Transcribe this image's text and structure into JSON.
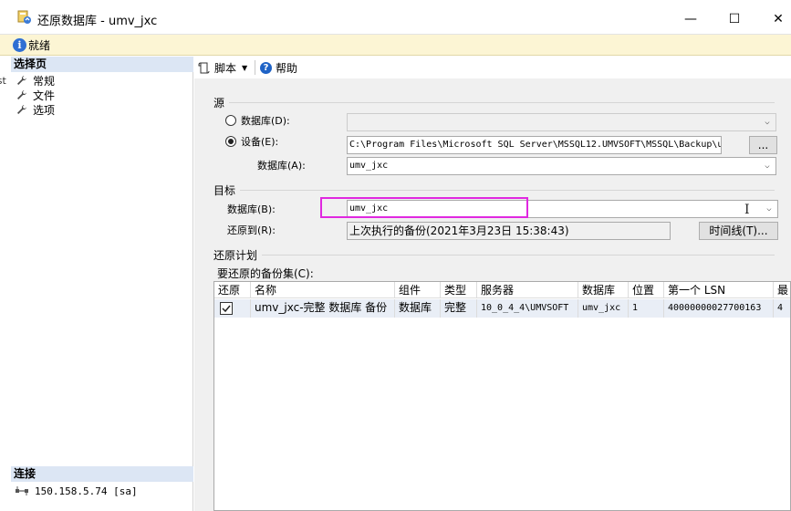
{
  "window": {
    "title": "还原数据库 - umv_jxc",
    "minimize_glyph": "—",
    "maximize_glyph": "☐",
    "close_glyph": "✕"
  },
  "status": {
    "icon": "info-icon",
    "text": "就绪"
  },
  "left_strip_text": "est",
  "sidebar": {
    "pages_header": "选择页",
    "items": [
      {
        "label": "常规",
        "icon": "wrench-icon"
      },
      {
        "label": "文件",
        "icon": "wrench-icon"
      },
      {
        "label": "选项",
        "icon": "wrench-icon"
      }
    ],
    "connection_header": "连接",
    "connection": "150.158.5.74 [sa]"
  },
  "toolbar": {
    "script_label": "脚本",
    "help_label": "帮助"
  },
  "source": {
    "group_label": "源",
    "database_radio_label": "数据库(D):",
    "device_radio_label": "设备(E):",
    "device_path": "C:\\Program Files\\Microsoft SQL Server\\MSSQL12.UMVSOFT\\MSSQL\\Backup\\u",
    "browse_button": "...",
    "database_label": "数据库(A):",
    "database_value": "umv_jxc"
  },
  "destination": {
    "group_label": "目标",
    "database_label": "数据库(B):",
    "database_value": "umv_jxc",
    "restore_to_label": "还原到(R):",
    "restore_to_value": "上次执行的备份(2021年3月23日 15:38:43)",
    "timeline_button": "时间线(T)..."
  },
  "plan": {
    "group_label": "还原计划",
    "backup_sets_label": "要还原的备份集(C):",
    "columns": [
      "还原",
      "名称",
      "组件",
      "类型",
      "服务器",
      "数据库",
      "位置",
      "第一个 LSN",
      "最"
    ],
    "rows": [
      {
        "restore": true,
        "name": "umv_jxc-完整 数据库 备份",
        "component": "数据库",
        "type": "完整",
        "server": "10_0_4_4\\UMVSOFT",
        "database": "umv_jxc",
        "position": "1",
        "first_lsn": "40000000027700163",
        "last": "4"
      }
    ]
  }
}
